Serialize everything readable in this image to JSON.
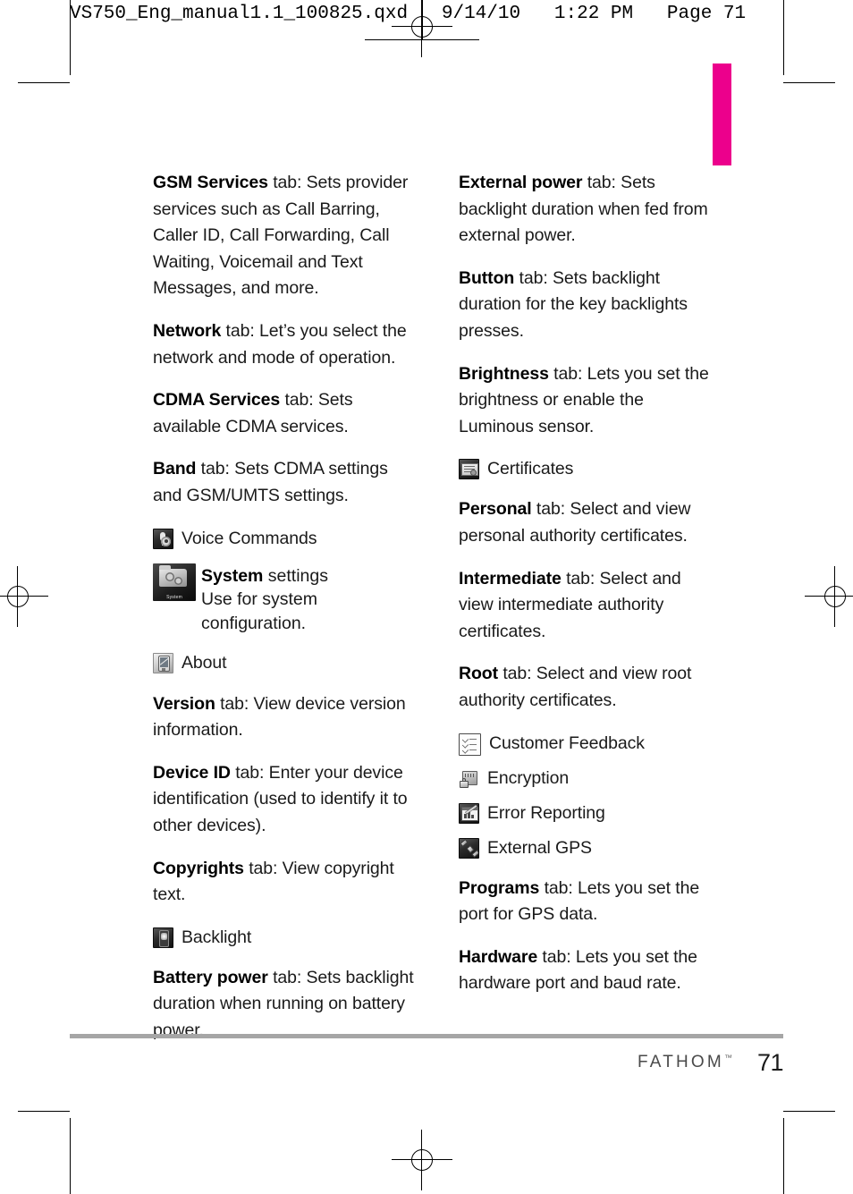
{
  "slug": {
    "text": "VS750_Eng_manual1.1_100825.qxd   9/14/10   1:22 PM   Page 71"
  },
  "theme": {
    "tab_marker_color": "#EC008C",
    "footer_rule_color": "#A6A6A6",
    "text_color": "#1A1A1A"
  },
  "footer": {
    "brand": "FATHOM",
    "trademark": "™",
    "page_number": "71"
  },
  "columns": {
    "left": [
      {
        "kind": "para",
        "term": "GSM Services",
        "body": " tab: Sets provider services such as Call Barring, Caller ID, Call Forwarding, Call Waiting, Voicemail and Text Messages, and more."
      },
      {
        "kind": "para",
        "term": "Network",
        "body": " tab: Let’s you select the network and mode of operation."
      },
      {
        "kind": "para",
        "term": "CDMA Services",
        "body": " tab: Sets available CDMA services."
      },
      {
        "kind": "para",
        "term": "Band",
        "body": " tab: Sets CDMA settings and GSM/UMTS settings."
      },
      {
        "kind": "icon",
        "icon": "voice-commands-icon",
        "label": "Voice Commands"
      },
      {
        "kind": "icon-system",
        "icon": "system-folder-icon",
        "icon_caption": "System",
        "term": "System",
        "label_rest": " settings",
        "sub_label": "Use for system configuration."
      },
      {
        "kind": "icon",
        "icon": "about-device-icon",
        "label": "About"
      },
      {
        "kind": "para",
        "term": "Version",
        "body": " tab: View device version information."
      },
      {
        "kind": "para",
        "term": "Device ID",
        "body": " tab: Enter your device identification (used to identify it to other devices)."
      },
      {
        "kind": "para",
        "term": "Copyrights",
        "body": " tab: View copyright text."
      },
      {
        "kind": "icon",
        "icon": "backlight-icon",
        "label": "Backlight"
      },
      {
        "kind": "para",
        "term": "Battery power",
        "body": " tab: Sets backlight duration when running on battery power."
      }
    ],
    "right": [
      {
        "kind": "para",
        "term": "External power",
        "body": " tab: Sets backlight duration when fed from external power."
      },
      {
        "kind": "para",
        "term": "Button",
        "body": " tab: Sets backlight duration for the key backlights presses."
      },
      {
        "kind": "para",
        "term": "Brightness",
        "body": " tab: Lets you set the brightness or enable the Luminous sensor."
      },
      {
        "kind": "icon",
        "icon": "certificates-icon",
        "label": "Certificates"
      },
      {
        "kind": "para",
        "term": "Personal",
        "body": " tab: Select and view personal authority certificates."
      },
      {
        "kind": "para",
        "term": "Intermediate",
        "body": " tab: Select and view intermediate authority certificates."
      },
      {
        "kind": "para",
        "term": "Root",
        "body": " tab: Select and view root authority certificates."
      },
      {
        "kind": "icon",
        "icon": "customer-feedback-icon",
        "label": "Customer Feedback"
      },
      {
        "kind": "icon",
        "icon": "encryption-icon",
        "label": "Encryption"
      },
      {
        "kind": "icon",
        "icon": "error-reporting-icon",
        "label": "Error Reporting"
      },
      {
        "kind": "icon",
        "icon": "external-gps-icon",
        "label": "External GPS"
      },
      {
        "kind": "para",
        "term": "Programs",
        "body": " tab: Lets you set the port for GPS data."
      },
      {
        "kind": "para",
        "term": "Hardware",
        "body": " tab: Lets you set the hardware port and baud rate."
      }
    ]
  }
}
